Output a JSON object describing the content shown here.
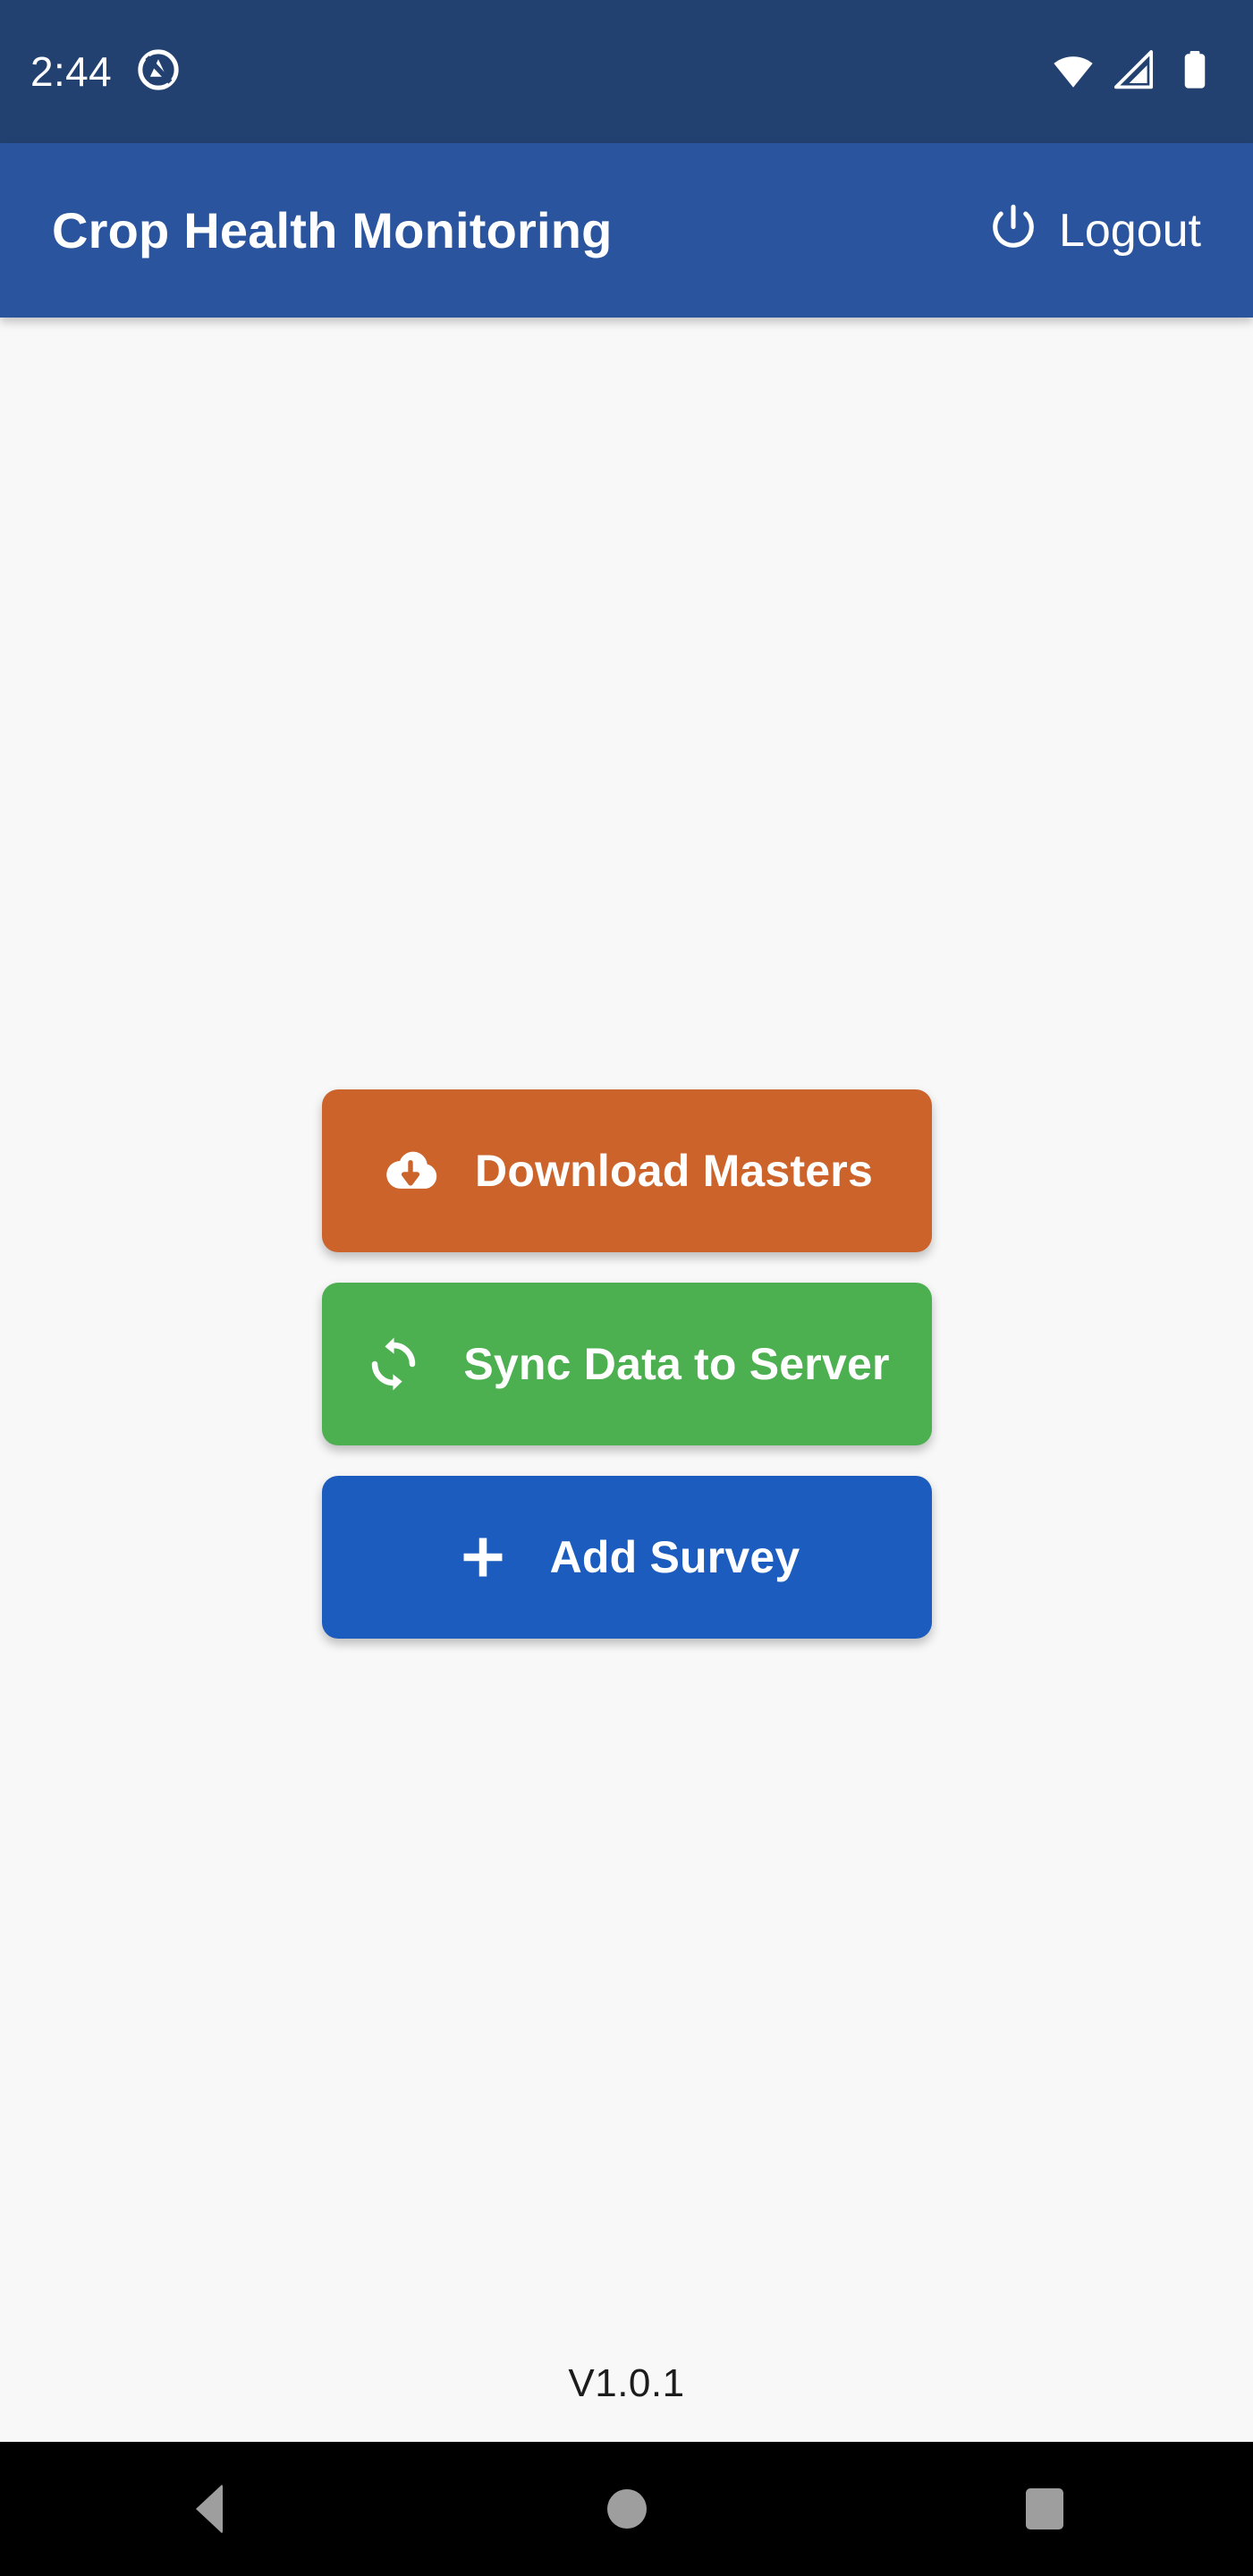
{
  "status_bar": {
    "time": "2:44",
    "background_color": "#234170",
    "icons": [
      {
        "name": "do-not-disturb-icon"
      },
      {
        "name": "wifi-icon"
      },
      {
        "name": "cellular-signal-icon"
      },
      {
        "name": "battery-icon"
      }
    ]
  },
  "app_bar": {
    "title": "Crop Health Monitoring",
    "background_color": "#2a559e",
    "logout_label": "Logout",
    "logout_icon": "power-icon"
  },
  "main": {
    "background_color": "#f8f8f8",
    "buttons": [
      {
        "label": "Download Masters",
        "icon": "cloud-download-icon",
        "color": "#cb632b"
      },
      {
        "label": "Sync Data to Server",
        "icon": "sync-icon",
        "color": "#4caf50"
      },
      {
        "label": "Add Survey",
        "icon": "plus-icon",
        "color": "#1b5cbe"
      }
    ],
    "version": "V1.0.1"
  },
  "nav_bar": {
    "background_color": "#000000",
    "buttons": [
      {
        "name": "back-button",
        "icon": "triangle-back-icon"
      },
      {
        "name": "home-button",
        "icon": "circle-home-icon"
      },
      {
        "name": "recents-button",
        "icon": "square-recents-icon"
      }
    ]
  }
}
